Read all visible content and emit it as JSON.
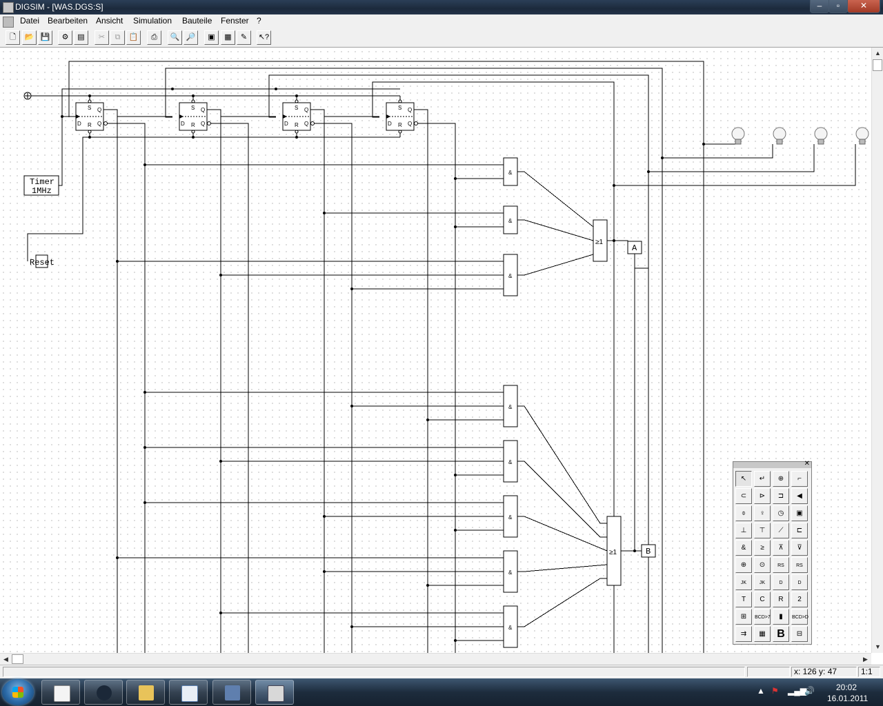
{
  "window": {
    "title": "DIGSIM - [WAS.DGS:S]",
    "minimize": "–",
    "maximize": "▫",
    "close": "✕"
  },
  "menu": [
    "Datei",
    "Bearbeiten",
    "Ansicht",
    "Simulation",
    "Bauteile",
    "Fenster",
    "?"
  ],
  "mdi": {
    "minimize": "_",
    "restore": "❐",
    "close": "✕"
  },
  "toolbar_icons": [
    "new-icon",
    "open-icon",
    "save-icon",
    "component-icon",
    "list-icon",
    "cut-icon",
    "copy-icon",
    "paste-icon",
    "print-icon",
    "zoom-in-icon",
    "zoom-out-icon",
    "diagram-icon",
    "grid-icon",
    "wire-icon",
    "help-pointer-icon"
  ],
  "circuit": {
    "timer_line1": "Timer",
    "timer_line2": "1MHz",
    "reset_label": "Reset",
    "ff_s": "S",
    "ff_q": "Q",
    "ff_d": "D",
    "ff_r": "R",
    "ff_qn": "Q",
    "and_symbol": "&",
    "or_symbol": "≥1",
    "output_a": "A",
    "output_b": "B"
  },
  "palette_icons": [
    "pointer-icon",
    "wire-tool-icon",
    "input-pin-icon",
    "step-icon",
    "clock-input-icon",
    "inverter-icon",
    "buffer-icon",
    "output-icon",
    "switch-icon",
    "lamp-icon",
    "clock-icon",
    "display-icon",
    "button-icon",
    "tap-icon",
    "toggle-icon",
    "relay-icon",
    "and-gate-icon",
    "or-gate-icon",
    "nand-icon",
    "nor-icon",
    "xor-icon",
    "xnor-icon",
    "rs-flipflop-icon",
    "rs-clocked-icon",
    "jk-flipflop-icon",
    "jk-clocked-icon",
    "d-flipflop-icon",
    "d-clocked-icon",
    "t-flipflop-icon",
    "counter-icon",
    "register-icon",
    "two-input-icon",
    "decoder-icon",
    "bcd-7seg-icon",
    "led-display-icon",
    "bcd-dec-icon",
    "mux-icon",
    "memory-icon",
    "bold-b-icon",
    "bus-icon"
  ],
  "palette_labels": {
    "rs": "RS",
    "jk": "JK",
    "d": "D",
    "bcd7": "BCD>7",
    "bcdd": "BCD>D",
    "bold_b": "B"
  },
  "status": {
    "coords": "x: 126 y: 47",
    "zoom": "1:1"
  },
  "taskbar": {
    "time": "20:02",
    "date": "16.01.2011"
  },
  "taskbar_apps": [
    "notepad-icon",
    "steam-icon",
    "explorer-icon",
    "spreadsheet-icon",
    "window-icon",
    "digsim-icon"
  ],
  "colors": {
    "titlebar": "#1f2f43",
    "taskbar": "#1d2c3d",
    "wire": "#000000"
  }
}
